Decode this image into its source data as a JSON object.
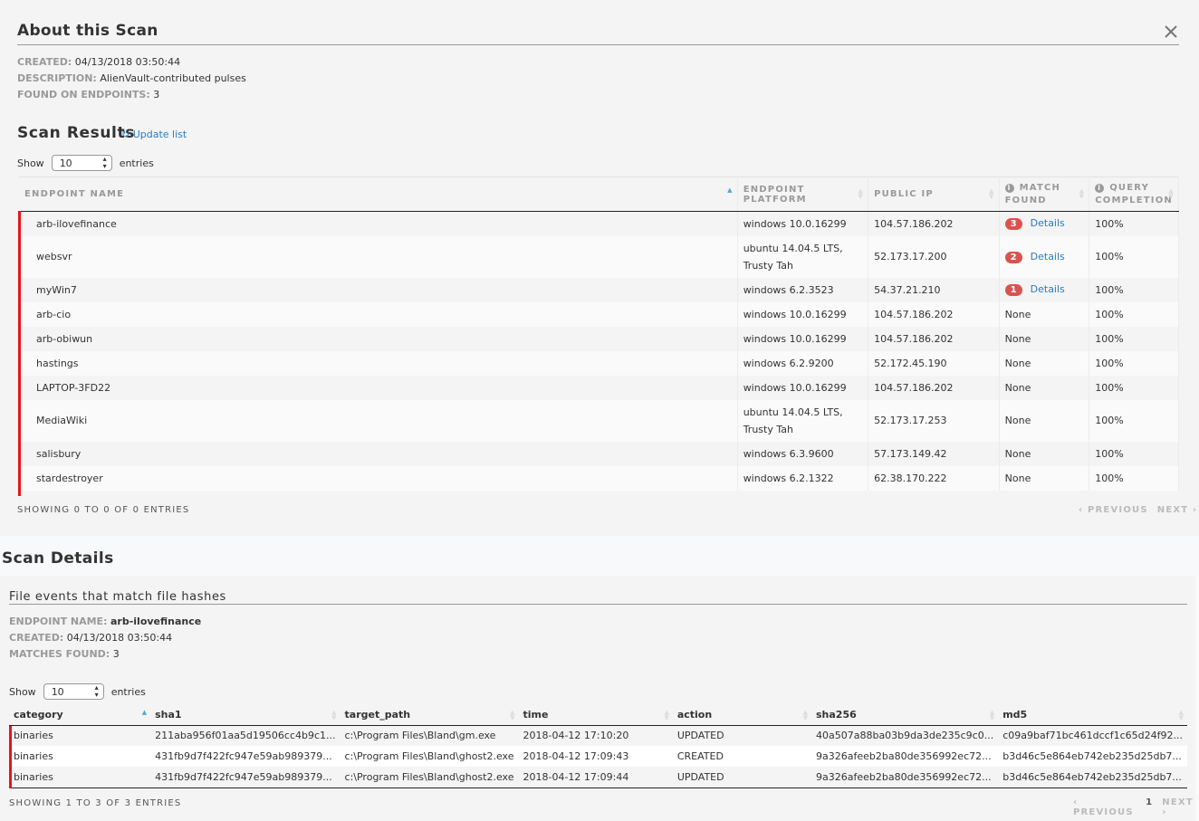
{
  "about": {
    "title": "About this Scan",
    "created_label": "CREATED:",
    "created_value": "04/13/2018 03:50:44",
    "description_label": "DESCRIPTION:",
    "description_value": "AlienVault-contributed pulses",
    "found_label": "FOUND ON ENDPOINTS:",
    "found_value": "3"
  },
  "results": {
    "title": "Scan Results",
    "update_label": "Update list",
    "show_label": "Show",
    "entries_label": "entries",
    "page_size": "10",
    "columns": [
      "ENDPOINT NAME",
      "ENDPOINT PLATFORM",
      "PUBLIC IP",
      "MATCH FOUND",
      "QUERY COMPLETION"
    ],
    "rows": [
      {
        "name": "arb-ilovefinance",
        "platform": "windows 10.0.16299",
        "ip": "104.57.186.202",
        "match": "3",
        "details": "Details",
        "completion": "100%"
      },
      {
        "name": "websvr",
        "platform": "ubuntu 14.04.5 LTS, Trusty Tah",
        "ip": "52.173.17.200",
        "match": "2",
        "details": "Details",
        "completion": "100%"
      },
      {
        "name": "myWin7",
        "platform": "windows 6.2.3523",
        "ip": "54.37.21.210",
        "match": "1",
        "details": "Details",
        "completion": "100%"
      },
      {
        "name": "arb-cio",
        "platform": "windows 10.0.16299",
        "ip": "104.57.186.202",
        "match": "None",
        "completion": "100%"
      },
      {
        "name": "arb-obiwun",
        "platform": "windows 10.0.16299",
        "ip": "104.57.186.202",
        "match": "None",
        "completion": "100%"
      },
      {
        "name": "hastings",
        "platform": "windows 6.2.9200",
        "ip": "52.172.45.190",
        "match": "None",
        "completion": "100%"
      },
      {
        "name": "LAPTOP-3FD22",
        "platform": "windows 10.0.16299",
        "ip": "104.57.186.202",
        "match": "None",
        "completion": "100%"
      },
      {
        "name": "MediaWiki",
        "platform": "ubuntu 14.04.5 LTS, Trusty Tah",
        "ip": "52.173.17.253",
        "match": "None",
        "completion": "100%"
      },
      {
        "name": "salisbury",
        "platform": "windows 6.3.9600",
        "ip": "57.173.149.42",
        "match": "None",
        "completion": "100%"
      },
      {
        "name": "stardestroyer",
        "platform": "windows 6.2.1322",
        "ip": "62.38.170.222",
        "match": "None",
        "completion": "100%"
      }
    ],
    "footer": "SHOWING 0 TO 0 OF 0 ENTRIES",
    "prev": "‹ PREVIOUS",
    "next": "NEXT ›"
  },
  "details": {
    "title": "Scan Details",
    "subtitle": "File events that match file hashes",
    "endpoint_label": "ENDPOINT NAME:",
    "endpoint_value": "arb-ilovefinance",
    "created_label": "CREATED:",
    "created_value": "04/13/2018 03:50:44",
    "matches_label": "MATCHES FOUND:",
    "matches_value": "3",
    "show_label": "Show",
    "entries_label": "entries",
    "page_size": "10",
    "columns": [
      "category",
      "sha1",
      "target_path",
      "time",
      "action",
      "sha256",
      "md5"
    ],
    "rows": [
      [
        "binaries",
        "211aba956f01aa5d19506cc4b9c1...",
        "c:\\Program Files\\Bland\\gm.exe",
        "2018-04-12 17:10:20",
        "UPDATED",
        "40a507a88ba03b9da3de235c9c0...",
        "c09a9baf71bc461dccf1c65d24f92..."
      ],
      [
        "binaries",
        "431fb9d7f422fc947e59ab989379...",
        "c:\\Program Files\\Bland\\ghost2.exe",
        "2018-04-12 17:09:43",
        "CREATED",
        "9a326afeeb2ba80de356992ec72...",
        "b3d46c5e864eb742eb235d25db7..."
      ],
      [
        "binaries",
        "431fb9d7f422fc947e59ab989379...",
        "c:\\Program Files\\Bland\\ghost2.exe",
        "2018-04-12 17:09:44",
        "UPDATED",
        "9a326afeeb2ba80de356992ec72...",
        "b3d46c5e864eb742eb235d25db7..."
      ]
    ],
    "footer": "SHOWING 1 TO 3 OF 3 ENTRIES",
    "prev": "‹ PREVIOUS",
    "page": "1",
    "next": "NEXT ›"
  },
  "colors": {
    "accent": "#2a7bc0",
    "alert": "#e8141b",
    "badge": "#d9534f"
  }
}
